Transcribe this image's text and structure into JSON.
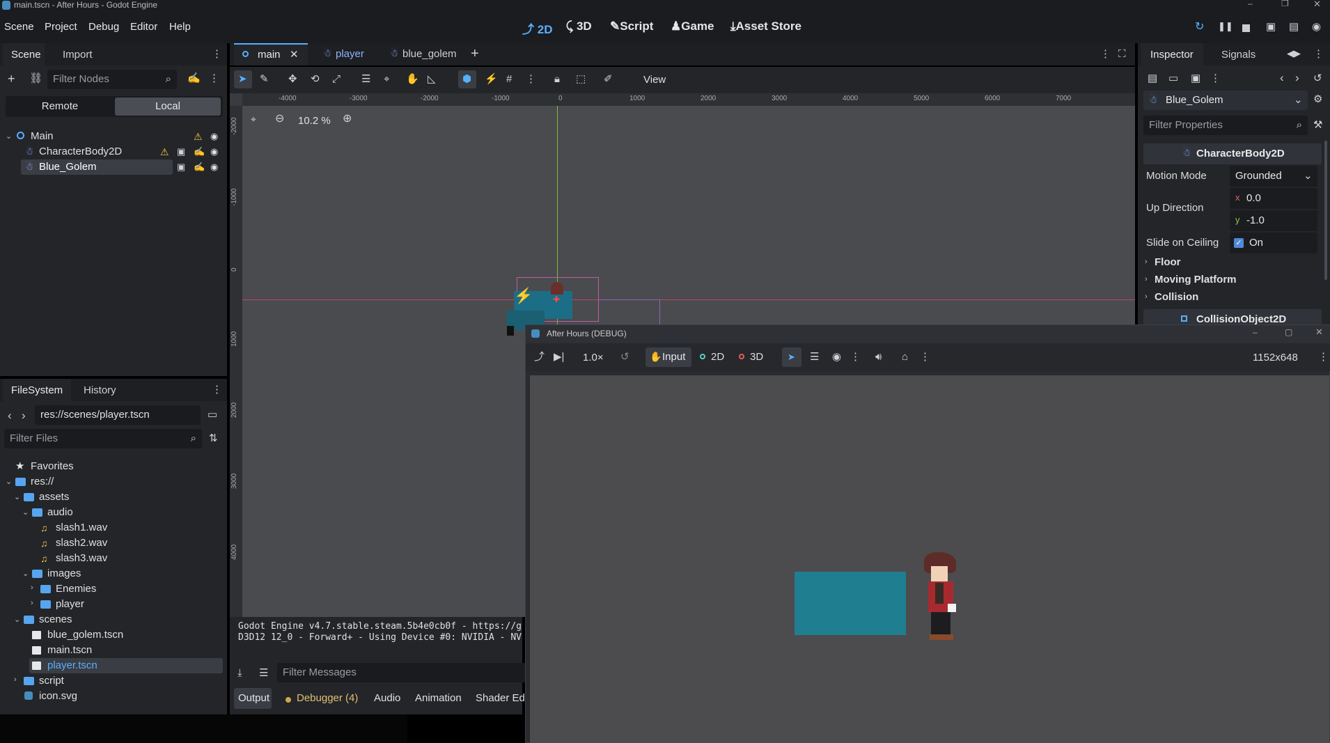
{
  "window": {
    "title": "main.tscn - After Hours - Godot Engine"
  },
  "menu": {
    "items": [
      "Scene",
      "Project",
      "Debug",
      "Editor",
      "Help"
    ]
  },
  "modes": {
    "d2": "2D",
    "d3": "3D",
    "script": "Script",
    "game": "Game",
    "asset_store": "Asset Store"
  },
  "scene_dock": {
    "tabs": [
      "Scene",
      "Import"
    ],
    "filter_placeholder": "Filter Nodes",
    "remote": "Remote",
    "local": "Local",
    "nodes": [
      "Main",
      "CharacterBody2D",
      "Blue_Golem"
    ]
  },
  "editor_tabs": [
    "main",
    "player",
    "blue_golem"
  ],
  "toolbar": {
    "view": "View"
  },
  "viewport": {
    "zoom": "10.2 %",
    "ruler_h": [
      "-4000",
      "-3000",
      "-2000",
      "-1000",
      "0",
      "1000",
      "2000",
      "3000",
      "4000",
      "5000",
      "6000",
      "7000"
    ],
    "ruler_v": [
      "-2000",
      "-1000",
      "0",
      "1000",
      "2000",
      "3000",
      "4000"
    ]
  },
  "filesystem": {
    "tabs": [
      "FileSystem",
      "History"
    ],
    "path": "res://scenes/player.tscn",
    "filter_placeholder": "Filter Files",
    "favorites": "Favorites",
    "root": "res://",
    "assets": "assets",
    "audio": "audio",
    "slash1": "slash1.wav",
    "slash2": "slash2.wav",
    "slash3": "slash3.wav",
    "images": "images",
    "enemies": "Enemies",
    "player": "player",
    "scenes": "scenes",
    "blue_golem": "blue_golem.tscn",
    "main": "main.tscn",
    "player_tscn": "player.tscn",
    "script": "script",
    "icon": "icon.svg"
  },
  "output": {
    "line1": "Godot Engine v4.7.stable.steam.5b4e0cb0f - https://g",
    "line2": "D3D12 12_0 - Forward+ - Using Device #0: NVIDIA - NV",
    "filter_placeholder": "Filter Messages"
  },
  "bottom_tabs": [
    "Output",
    "Debugger (4)",
    "Audio",
    "Animation",
    "Shader Edi"
  ],
  "inspector": {
    "tabs": [
      "Inspector",
      "Signals"
    ],
    "node_name": "Blue_Golem",
    "filter_placeholder": "Filter Properties",
    "class_header": "CharacterBody2D",
    "motion_mode_label": "Motion Mode",
    "motion_mode_value": "Grounded",
    "up_direction_label": "Up Direction",
    "x_label": "x",
    "y_label": "y",
    "up_x": "0.0",
    "up_y": "-1.0",
    "slide_label": "Slide on Ceiling",
    "slide_value": "On",
    "groups": [
      "Floor",
      "Moving Platform",
      "Collision"
    ],
    "collision_object": "CollisionObject2D"
  },
  "debug_window": {
    "title": "After Hours (DEBUG)",
    "speed": "1.0×",
    "input": "Input",
    "d2": "2D",
    "d3": "3D",
    "resolution": "1152x648"
  },
  "colors": {
    "accent": "#57b0ff",
    "background": "#232529",
    "viewport": "#4a4b4f",
    "golem_box": "#1f7e90"
  }
}
